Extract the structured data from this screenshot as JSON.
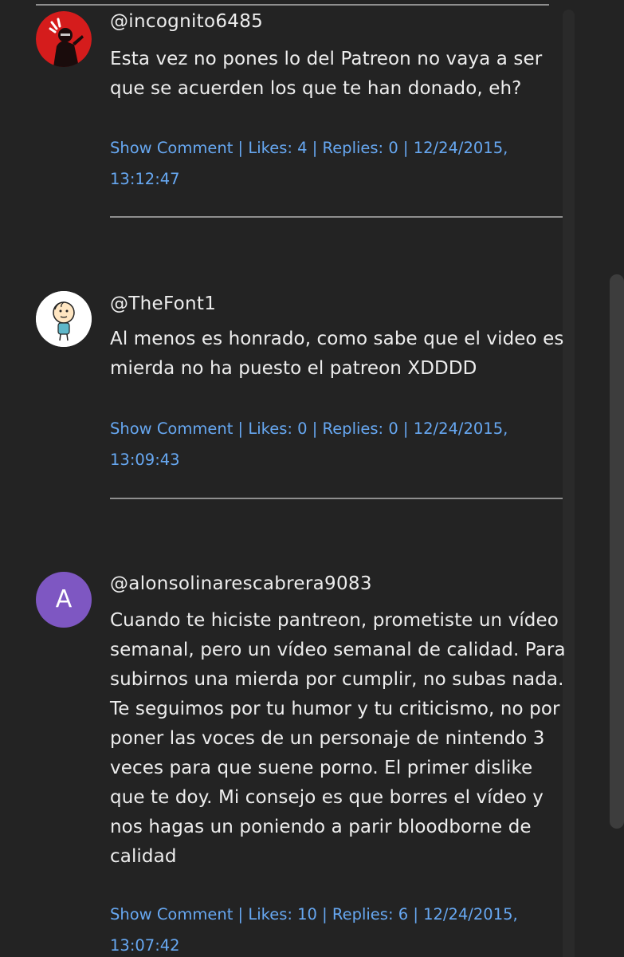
{
  "comments": [
    {
      "username": "@incognito6485",
      "text": "Esta vez no pones lo del Patreon no vaya a ser que se acuerden los que te han donado, eh?",
      "show_comment": "Show Comment",
      "likes": "Likes: 4",
      "replies": "Replies: 0",
      "date": "12/24/2015,",
      "time": "13:12:47",
      "avatar_icon": "red-figure-avatar-icon"
    },
    {
      "username": "@TheFont1",
      "text": "Al menos es honrado, como sabe que el video es mierda no ha puesto el patreon XDDDD",
      "show_comment": "Show Comment",
      "likes": "Likes: 0",
      "replies": "Replies: 0",
      "date": "12/24/2015,",
      "time": "13:09:43",
      "avatar_icon": "cartoon-boy-avatar-icon"
    },
    {
      "username": "@alonsolinarescabrera9083",
      "text": "Cuando te hiciste pantreon, prometiste un vídeo semanal, pero un vídeo semanal de calidad. Para subirnos una mierda por cumplir, no subas nada. Te seguimos por tu humor y tu criticismo, no por poner las voces de un personaje de nintendo 3 veces para que suene porno. El primer dislike que te doy. Mi consejo es que borres el vídeo y nos hagas un poniendo a parir bloodborne de calidad",
      "show_comment": "Show Comment",
      "likes": "Likes: 10",
      "replies": "Replies: 6",
      "date": "12/24/2015,",
      "time": "13:07:42",
      "avatar_letter": "A",
      "avatar_color": "#7e57c2"
    }
  ],
  "separator": " | ",
  "colors": {
    "background": "#232323",
    "text": "#ededed",
    "link": "#67a8f2",
    "divider": "#8e8e8e"
  }
}
